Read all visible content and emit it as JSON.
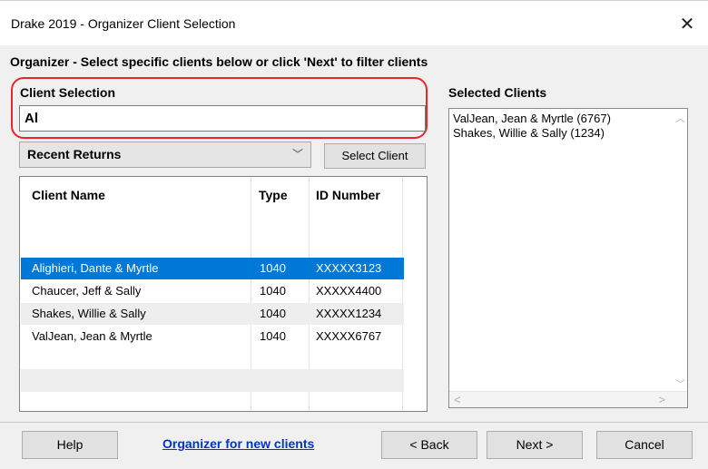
{
  "window": {
    "title": "Drake 2019 - Organizer Client Selection",
    "close_glyph": "✕"
  },
  "instruction": "Organizer - Select specific clients below or click 'Next' to filter clients",
  "client_selection": {
    "label": "Client Selection",
    "value": "Al"
  },
  "selected_clients": {
    "label": "Selected Clients",
    "items": [
      "ValJean, Jean & Myrtle (6767)",
      "Shakes, Willie & Sally (1234)"
    ]
  },
  "filter": {
    "selected": "Recent Returns",
    "select_button": "Select Client"
  },
  "table": {
    "headers": [
      "Client Name",
      "Type",
      "ID Number"
    ],
    "rows": [
      {
        "name": "Alighieri, Dante & Myrtle",
        "type": "1040",
        "id": "XXXXX3123"
      },
      {
        "name": "Chaucer, Jeff & Sally",
        "type": "1040",
        "id": "XXXXX4400"
      },
      {
        "name": "Shakes, Willie & Sally",
        "type": "1040",
        "id": "XXXXX1234"
      },
      {
        "name": "ValJean, Jean & Myrtle",
        "type": "1040",
        "id": "XXXXX6767"
      }
    ]
  },
  "buttons": {
    "help": "Help",
    "back": "< Back",
    "next": "Next >",
    "cancel": "Cancel"
  },
  "link": "Organizer for new clients",
  "colors": {
    "highlight_ring": "#e8262b",
    "selection": "#0078d7",
    "link": "#0033cc"
  },
  "icons": {
    "close": "close-icon",
    "dropdown": "chevron-down-icon",
    "scroll_up": "chevron-up-icon",
    "scroll_down": "chevron-down-icon",
    "scroll_left": "chevron-left-icon",
    "scroll_right": "chevron-right-icon"
  }
}
